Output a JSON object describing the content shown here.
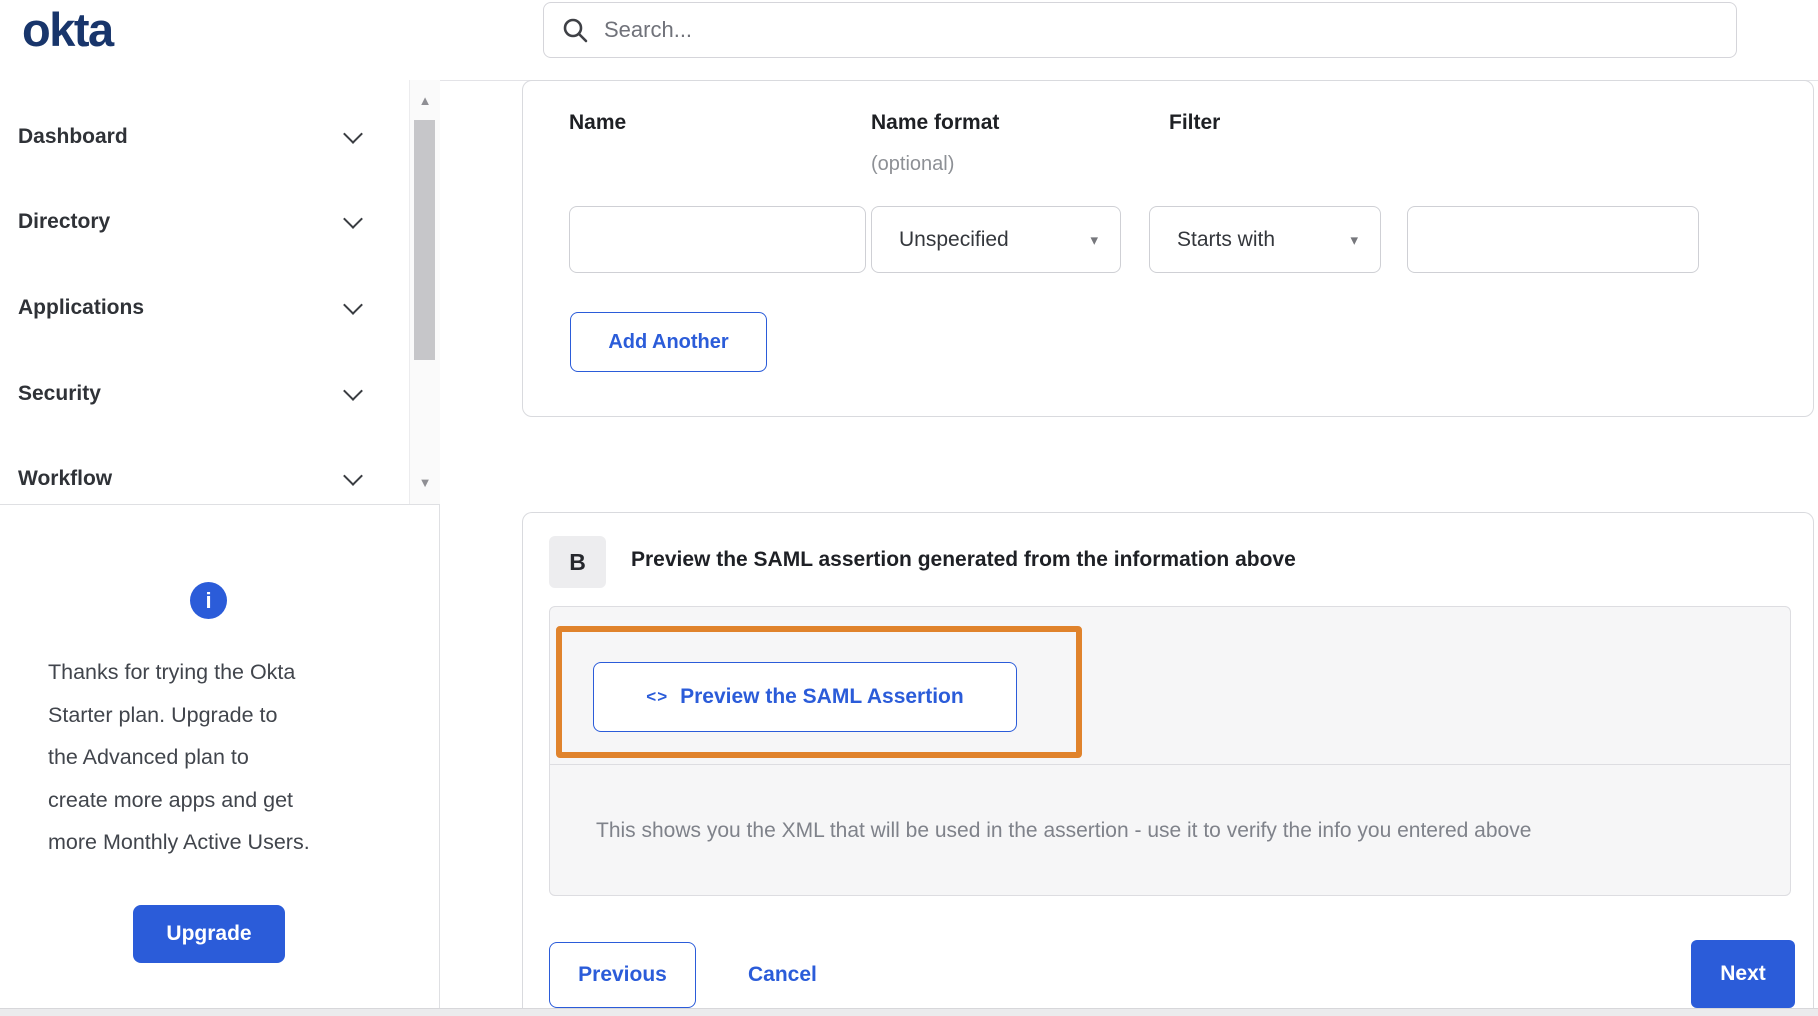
{
  "header": {
    "logo": "okta",
    "search_placeholder": "Search..."
  },
  "sidebar": {
    "items": [
      {
        "label": "Dashboard"
      },
      {
        "label": "Directory"
      },
      {
        "label": "Applications"
      },
      {
        "label": "Security"
      },
      {
        "label": "Workflow"
      }
    ]
  },
  "upsell": {
    "lines": [
      "Thanks for trying the Okta",
      "Starter plan. Upgrade to",
      "the Advanced plan to",
      "create more apps and get",
      "more Monthly Active Users."
    ],
    "upgrade_label": "Upgrade"
  },
  "attribute_form": {
    "name_label": "Name",
    "name_format_label": "Name format",
    "name_format_hint": "(optional)",
    "filter_label": "Filter",
    "name_value": "",
    "name_format_value": "Unspecified",
    "filter_type_value": "Starts with",
    "filter_value": "",
    "add_another_label": "Add Another"
  },
  "preview_section": {
    "step_badge": "B",
    "heading": "Preview the SAML assertion generated from the information above",
    "preview_button_label": "Preview the SAML Assertion",
    "note": "This shows you the XML that will be used in the assertion - use it to verify the info you entered above"
  },
  "footer": {
    "previous_label": "Previous",
    "cancel_label": "Cancel",
    "next_label": "Next"
  },
  "icons": {
    "info": "i",
    "code": "<>",
    "caret": "▾",
    "scroll_up": "▲",
    "scroll_down": "▼"
  },
  "colors": {
    "accent_blue": "#2b5cd9",
    "logo_navy": "#18356b",
    "highlight_orange": "#e0832c",
    "panel_border": "#d9dade",
    "gray_panel_bg": "#f6f6f7"
  }
}
